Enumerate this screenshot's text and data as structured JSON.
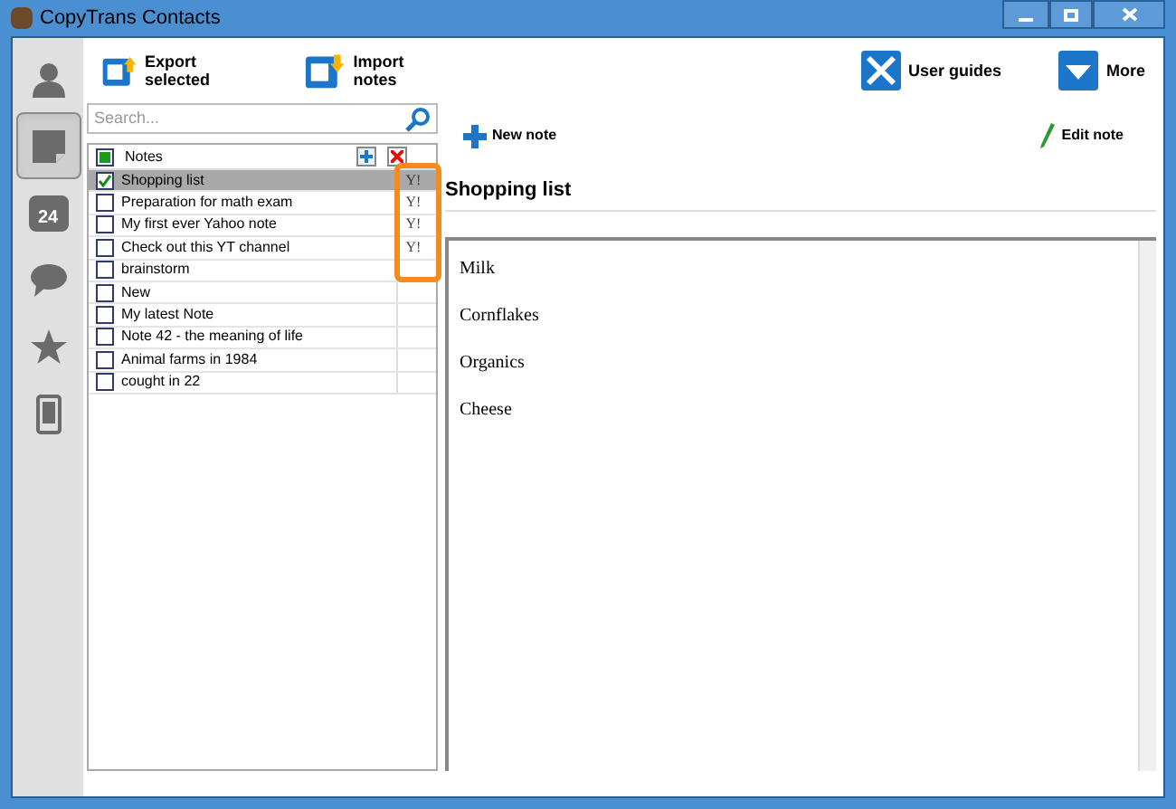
{
  "window": {
    "title": "CopyTrans Contacts"
  },
  "sidebar": {
    "items": [
      {
        "kind": "contacts",
        "selected": false
      },
      {
        "kind": "notes",
        "selected": true
      },
      {
        "kind": "calendar",
        "selected": false,
        "badge": "24"
      },
      {
        "kind": "messages",
        "selected": false
      },
      {
        "kind": "favorites",
        "selected": false
      },
      {
        "kind": "device",
        "selected": false
      }
    ]
  },
  "toolbar": [
    {
      "kind": "export",
      "label": "Export selected"
    },
    {
      "kind": "import",
      "label": "Import notes"
    },
    {
      "kind": "guides",
      "label": "User guides"
    },
    {
      "kind": "more",
      "label": "More"
    }
  ],
  "search": {
    "placeholder": "Search..."
  },
  "notes": {
    "header": "Notes",
    "header_checked": true,
    "rows": [
      {
        "title": "Shopping list",
        "checked": true,
        "selected": true,
        "source": "Y!"
      },
      {
        "title": "Preparation for math exam",
        "checked": false,
        "selected": false,
        "source": "Y!"
      },
      {
        "title": "My first ever Yahoo note",
        "checked": false,
        "selected": false,
        "source": "Y!"
      },
      {
        "title": "Check out this YT channel",
        "checked": false,
        "selected": false,
        "source": "Y!"
      },
      {
        "title": "brainstorm",
        "checked": false,
        "selected": false
      },
      {
        "title": "New",
        "checked": false,
        "selected": false
      },
      {
        "title": "My latest Note",
        "checked": false,
        "selected": false
      },
      {
        "title": "Note 42 - the meaning of life",
        "checked": false,
        "selected": false
      },
      {
        "title": "Animal farms in 1984",
        "checked": false,
        "selected": false
      },
      {
        "title": "cought in 22",
        "checked": false,
        "selected": false
      }
    ]
  },
  "actions": {
    "new_note": "New note",
    "edit_note": "Edit note"
  },
  "note": {
    "title": "Shopping list",
    "lines": [
      "Milk",
      "Cornflakes",
      "Organics",
      "Cheese"
    ]
  }
}
